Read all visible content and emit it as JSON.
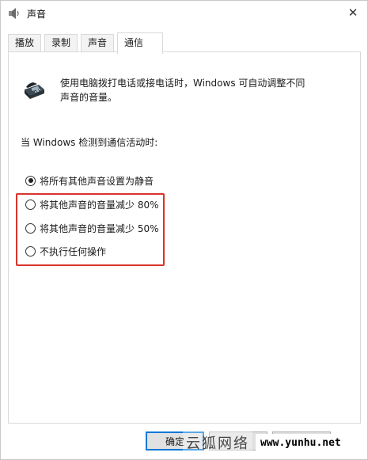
{
  "window": {
    "title": "声音"
  },
  "tabs": [
    {
      "label": "播放",
      "active": false
    },
    {
      "label": "录制",
      "active": false
    },
    {
      "label": "声音",
      "active": false
    },
    {
      "label": "通信",
      "active": true
    }
  ],
  "communications": {
    "description_line1": "使用电脑拨打电话或接电话时，Windows 可自动调整不同",
    "description_line2": "声音的音量。",
    "question": "当 Windows 检测到通信活动时:",
    "options": [
      {
        "label": "将所有其他声音设置为静音",
        "checked": true
      },
      {
        "label": "将其他声音的音量减少 80%",
        "checked": false
      },
      {
        "label": "将其他声音的音量减少 50%",
        "checked": false
      },
      {
        "label": "不执行任何操作",
        "checked": false
      }
    ]
  },
  "buttons": {
    "ok": "确定",
    "cancel": "",
    "apply": ""
  },
  "watermark": {
    "text": "云狐网络",
    "site": "www.yunhu.net"
  },
  "colors": {
    "highlight": "#d9342b",
    "focus": "#0078d7"
  }
}
